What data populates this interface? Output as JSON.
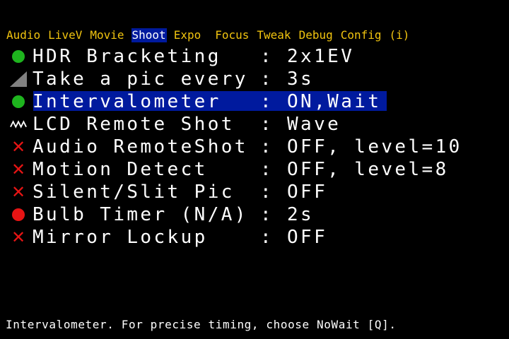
{
  "tabs": [
    {
      "label": "Audio",
      "active": false
    },
    {
      "label": "LiveV",
      "active": false
    },
    {
      "label": "Movie",
      "active": false
    },
    {
      "label": "Shoot",
      "active": true
    },
    {
      "label": "Expo",
      "active": false
    },
    {
      "label": "Focus",
      "active": false
    },
    {
      "label": "Tweak",
      "active": false
    },
    {
      "label": "Debug",
      "active": false
    },
    {
      "label": "Config",
      "active": false
    },
    {
      "label": "(i)",
      "active": false
    }
  ],
  "menu": {
    "items": [
      {
        "icon": "green-dot-icon",
        "label": "HDR Bracketing",
        "colon": ":",
        "value": "2x1EV"
      },
      {
        "icon": "ramp-icon",
        "label": "Take a pic every",
        "colon": ":",
        "value": "3s"
      },
      {
        "icon": "green-dot-icon",
        "label": "Intervalometer",
        "colon": ":",
        "value": "ON,Wait",
        "selected": true
      },
      {
        "icon": "wave-icon",
        "label": "LCD Remote Shot",
        "colon": ":",
        "value": "Wave"
      },
      {
        "icon": "red-x-icon",
        "label": "Audio RemoteShot",
        "colon": ":",
        "value": "OFF, level=10"
      },
      {
        "icon": "red-x-icon",
        "label": "Motion Detect",
        "colon": ":",
        "value": "OFF, level=8"
      },
      {
        "icon": "red-x-icon",
        "label": "Silent/Slit Pic",
        "colon": ":",
        "value": "OFF"
      },
      {
        "icon": "red-dot-icon",
        "label": "Bulb Timer (N/A)",
        "colon": ":",
        "value": "2s"
      },
      {
        "icon": "red-x-icon",
        "label": "Mirror Lockup",
        "colon": ":",
        "value": "OFF"
      }
    ]
  },
  "help": {
    "text": "Intervalometer. For precise timing, choose NoWait [Q]."
  },
  "colors": {
    "background": "#000000",
    "tab_text": "#f1c40f",
    "highlight": "#001a9e",
    "text": "#ffffff",
    "on_icon": "#1eb41e",
    "off_icon": "#e61414",
    "ramp_icon": "#808080"
  }
}
